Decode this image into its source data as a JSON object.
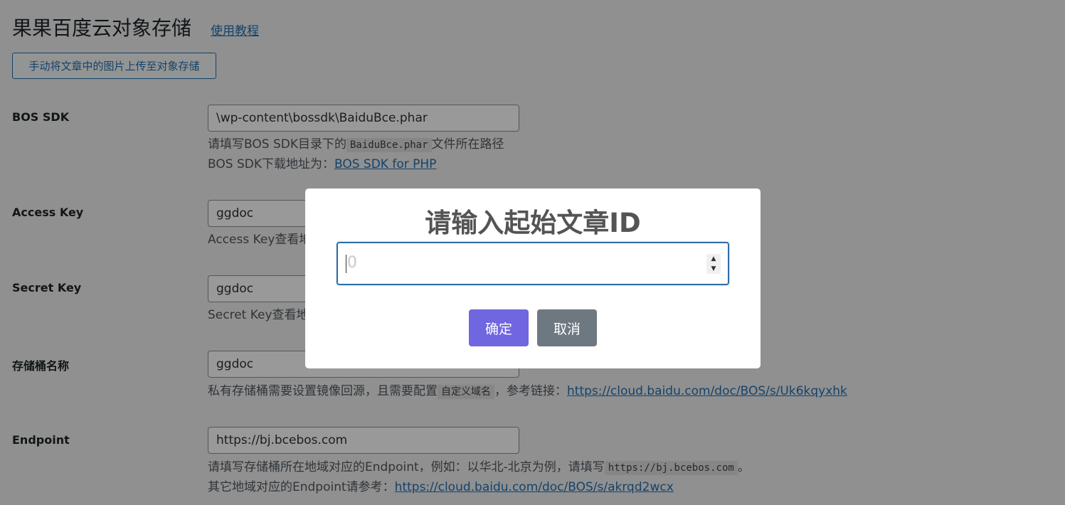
{
  "header": {
    "title": "果果百度云对象存储",
    "tutorial_link": "使用教程",
    "upload_button": "手动将文章中的图片上传至对象存储"
  },
  "fields": [
    {
      "label": "BOS SDK",
      "value": "\\wp-content\\bossdk\\BaiduBce.phar",
      "desc_line1_before": "请填写BOS SDK目录下的",
      "desc_line1_code": "BaiduBce.phar",
      "desc_line1_after": "文件所在路径",
      "desc_line2_text": "BOS SDK下载地址为：",
      "desc_line2_link": "BOS SDK for PHP"
    },
    {
      "label": "Access Key",
      "value": "ggdoc",
      "desc_text": "Access Key查看地址："
    },
    {
      "label": "Secret Key",
      "value": "ggdoc",
      "desc_text": "Secret Key查看地址："
    },
    {
      "label": "存储桶名称",
      "value": "ggdoc",
      "desc_before": "私有存储桶需要设置镜像回源，且需要配置",
      "desc_code": "自定义域名",
      "desc_middle": "，参考链接：",
      "desc_link": "https://cloud.baidu.com/doc/BOS/s/Uk6kqyxhk"
    },
    {
      "label": "Endpoint",
      "value": "https://bj.bcebos.com",
      "desc_line1_before": "请填写存储桶所在地域对应的Endpoint，例如：以华北-北京为例，请填写",
      "desc_line1_code": "https://bj.bcebos.com",
      "desc_line1_after": "。",
      "desc_line2_text": "其它地域对应的Endpoint请参考：",
      "desc_line2_link": "https://cloud.baidu.com/doc/BOS/s/akrqd2wcx"
    }
  ],
  "modal": {
    "title": "请输入起始文章ID",
    "input_placeholder": "0",
    "confirm_label": "确定",
    "cancel_label": "取消",
    "confirm_color": "#7066e0",
    "cancel_color": "#6e7881"
  },
  "icons": {
    "spin_up": "▲",
    "spin_down": "▼"
  }
}
